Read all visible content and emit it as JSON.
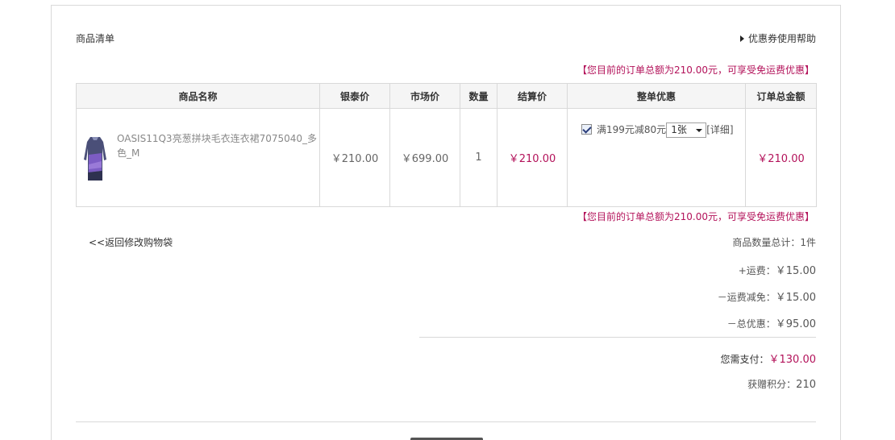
{
  "header": {
    "title": "商品清单",
    "help_link": "优惠券使用帮助"
  },
  "promo_notice": "【您目前的订单总额为210.00元，可享受免运费优惠】",
  "table": {
    "columns": [
      "商品名称",
      "银泰价",
      "市场价",
      "数量",
      "结算价",
      "整单优惠",
      "订单总金额"
    ],
    "rows": [
      {
        "product_name": "OASIS11Q3亮葱拼块毛衣连衣裙7075040_多色_M",
        "intime_price": "￥210.00",
        "market_price": "￥699.00",
        "quantity": "1",
        "settle_price": "￥210.00",
        "promo": {
          "label": "满199元减80元",
          "selected": "1张",
          "detail": "[详细]"
        },
        "order_total": "￥210.00"
      }
    ]
  },
  "back_link": "<<返回修改购物袋",
  "summary": {
    "item_count_label": "商品数量总计：",
    "item_count_value": "1件",
    "shipping_label": "+运费：",
    "shipping_value": "￥15.00",
    "shipping_waiver_label": "－运费减免：",
    "shipping_waiver_value": "￥15.00",
    "discount_label": "－总优惠：",
    "discount_value": "￥95.00",
    "payable_label": "您需支付：",
    "payable_value": "￥130.00",
    "points_label": "获赠积分：",
    "points_value": "210"
  },
  "colors": {
    "accent": "#b3125a",
    "border": "#d9d9d9",
    "header_bg": "#f5f5f5"
  }
}
